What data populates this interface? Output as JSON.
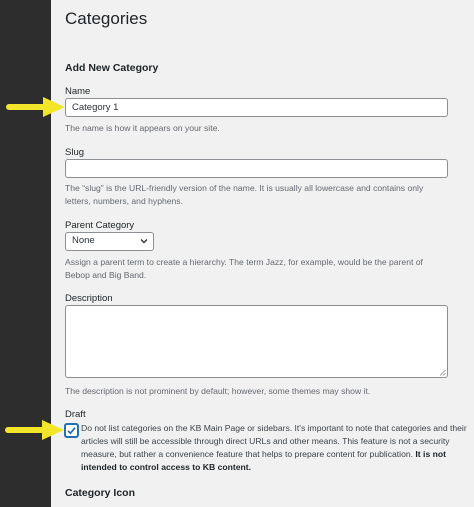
{
  "page": {
    "title": "Categories",
    "section_title": "Add New Category"
  },
  "name_field": {
    "label": "Name",
    "value": "Category 1",
    "help": "The name is how it appears on your site."
  },
  "slug_field": {
    "label": "Slug",
    "value": "",
    "help": "The “slug” is the URL-friendly version of the name. It is usually all lowercase and contains only letters, numbers, and hyphens."
  },
  "parent_field": {
    "label": "Parent Category",
    "selected": "None",
    "help": "Assign a parent term to create a hierarchy. The term Jazz, for example, would be the parent of Bebop and Big Band."
  },
  "description_field": {
    "label": "Description",
    "value": "",
    "help": "The description is not prominent by default; however, some themes may show it."
  },
  "draft_field": {
    "label": "Draft",
    "checked": true,
    "text": "Do not list categories on the KB Main Page or sidebars. It's important to note that categories and their articles will still be accessible through direct URLs and other means. This feature is not a security measure, but rather a convenience feature that helps to prepare content for publication.",
    "bold_text": "It is not intended to control access to KB content."
  },
  "category_icon": {
    "label": "Category Icon"
  },
  "colors": {
    "sidebar": "#2d2d2d",
    "background": "#f1f1f1",
    "arrow": "#f2e52a",
    "accent": "#2271b1"
  }
}
